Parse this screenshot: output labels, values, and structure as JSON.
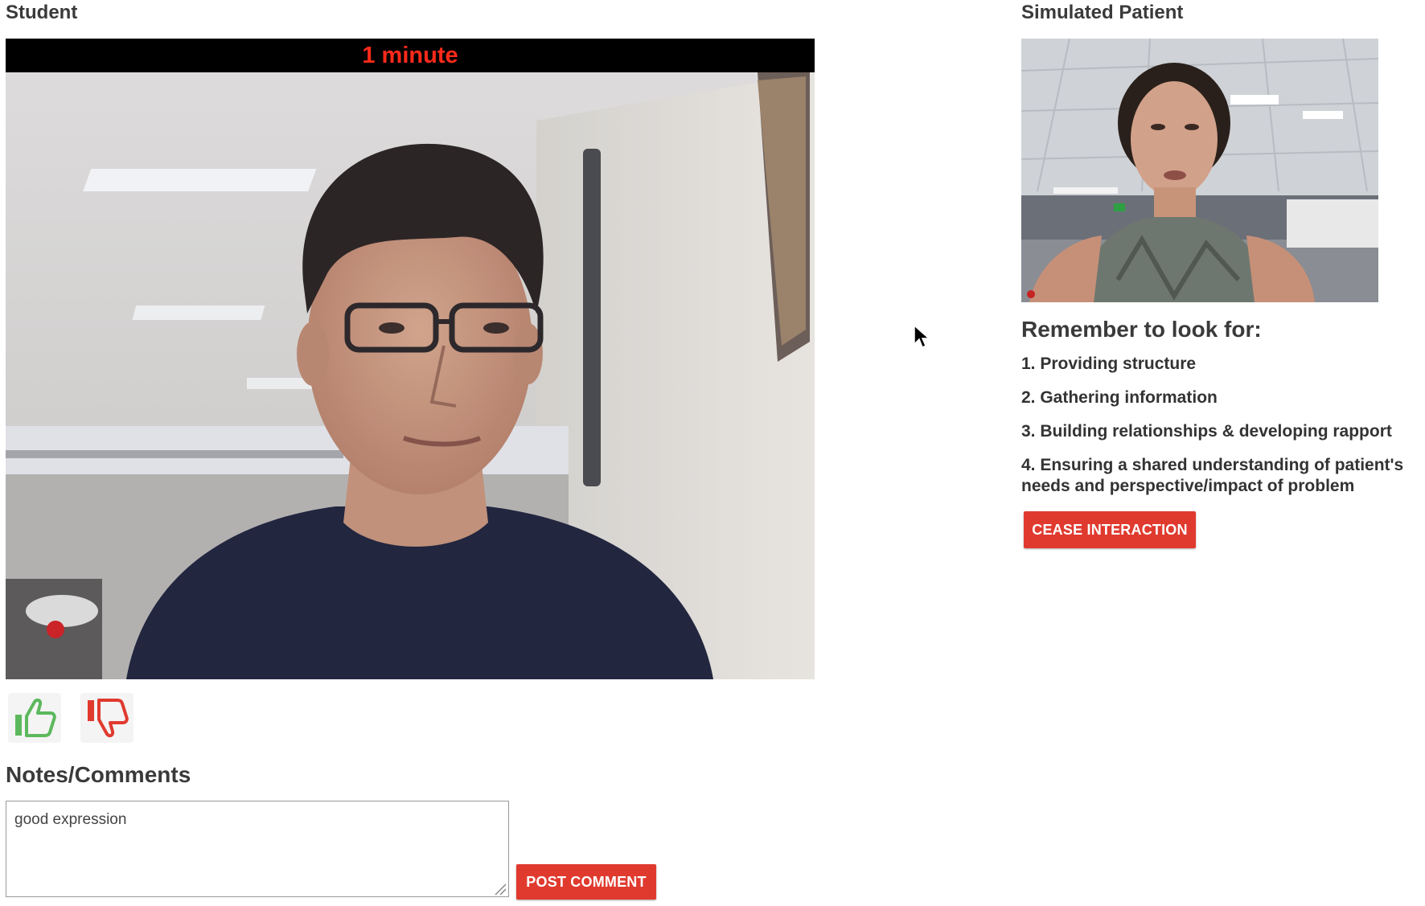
{
  "student": {
    "heading": "Student",
    "timer": "1 minute"
  },
  "patient": {
    "heading": "Simulated Patient"
  },
  "rating": {
    "thumbs_up_icon": "thumbs-up-icon",
    "thumbs_down_icon": "thumbs-down-icon"
  },
  "notes": {
    "heading": "Notes/Comments",
    "comment_value": "good expression",
    "post_button": "POST COMMENT"
  },
  "checklist": {
    "heading": "Remember to look for:",
    "items": [
      "1. Providing structure",
      "2. Gathering information",
      "3. Building relationships & developing rapport",
      "4. Ensuring a shared understanding of patient's needs and perspective/impact of problem"
    ]
  },
  "actions": {
    "cease_button": "CEASE INTERACTION"
  },
  "colors": {
    "timer_text": "#ff2a1a",
    "button_red": "#e03a2f",
    "thumbs_up": "#5cb85c",
    "thumbs_down": "#e03a2f"
  }
}
